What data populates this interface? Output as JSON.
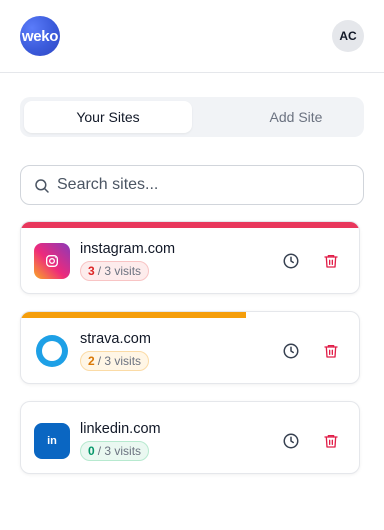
{
  "header": {
    "logo_text": "weko",
    "avatar_initials": "AC"
  },
  "tabs": [
    {
      "label": "Your Sites",
      "active": true
    },
    {
      "label": "Add Site",
      "active": false
    }
  ],
  "search": {
    "placeholder": "Search sites...",
    "value": ""
  },
  "sites": [
    {
      "name": "instagram.com",
      "visits_used": "3",
      "visits_sep": "/ 3 visits",
      "usage_fraction": 1.0,
      "bar_color": "#e8375c",
      "count_color": "#dc2626",
      "badge_bg": "#fdecec",
      "badge_border": "#f8c4c4",
      "icon": "instagram-icon"
    },
    {
      "name": "strava.com",
      "visits_used": "2",
      "visits_sep": "/ 3 visits",
      "usage_fraction": 0.667,
      "bar_color": "#f59e0b",
      "count_color": "#d97706",
      "badge_bg": "#fff6e6",
      "badge_border": "#fbdba6",
      "icon": "strava-icon"
    },
    {
      "name": "linkedin.com",
      "visits_used": "0",
      "visits_sep": "/ 3 visits",
      "usage_fraction": 0,
      "bar_color": "#10b981",
      "count_color": "#059669",
      "badge_bg": "#eaf8f1",
      "badge_border": "#b7e9cf",
      "icon": "linkedin-icon"
    }
  ],
  "colors": {
    "delete": "#e11d48",
    "history": "#374151",
    "accent": "#3b5bdb"
  }
}
